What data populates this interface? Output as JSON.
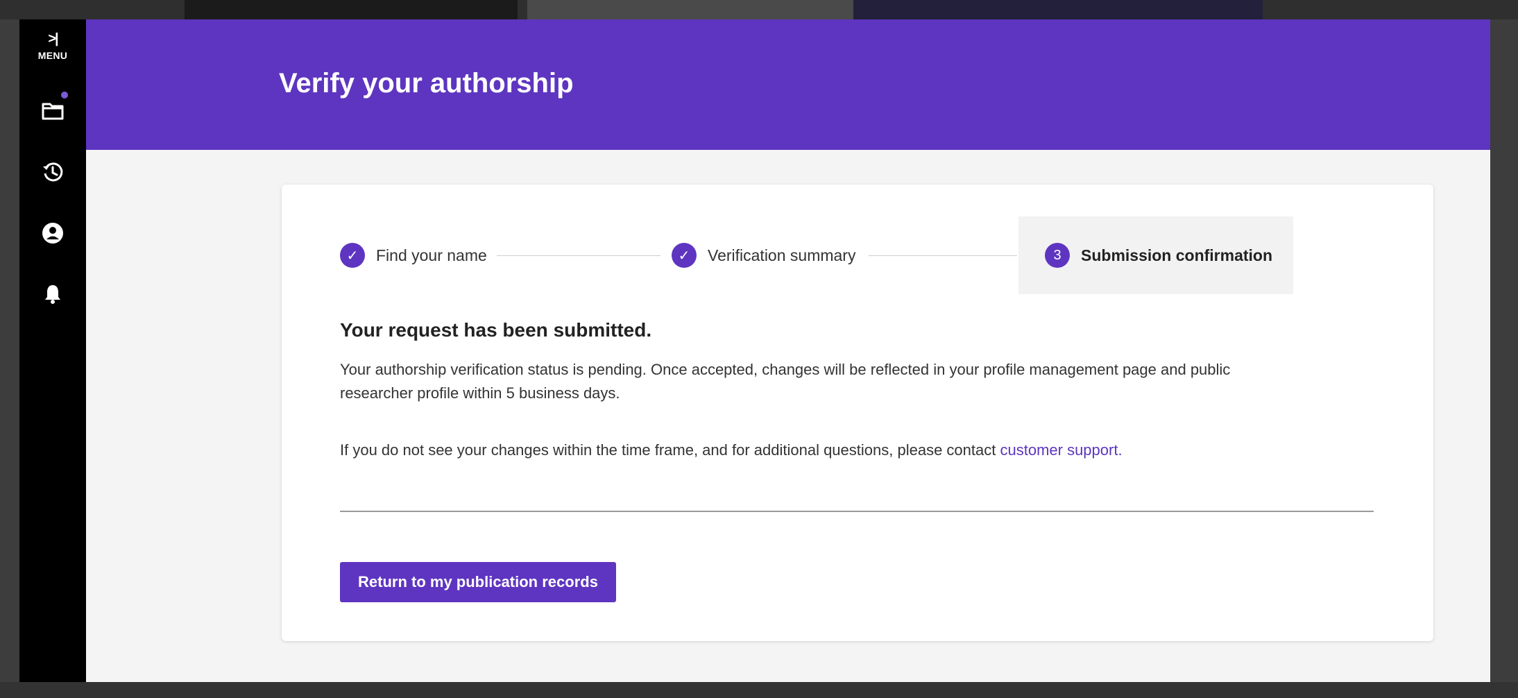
{
  "nav": {
    "menu_chevron": ">|",
    "menu_label": "MENU"
  },
  "header": {
    "title": "Verify your authorship"
  },
  "stepper": {
    "steps": [
      {
        "label": "Find your name",
        "state": "complete",
        "marker": "✓"
      },
      {
        "label": "Verification summary",
        "state": "complete",
        "marker": "✓"
      },
      {
        "label": "Submission confirmation",
        "state": "current",
        "marker": "3"
      }
    ]
  },
  "confirmation": {
    "heading": "Your request has been submitted.",
    "status_text": "Your authorship verification status is pending. Once accepted, changes will be reflected in your profile management page and public researcher profile within 5 business days.",
    "help_text": "If you do not see your changes within the time frame, and for additional questions, please contact",
    "support_link": "customer support."
  },
  "actions": {
    "return_label": "Return to my publication records"
  },
  "colors": {
    "brand": "#5e35c0",
    "rail": "#000000",
    "background": "#f4f4f4"
  }
}
